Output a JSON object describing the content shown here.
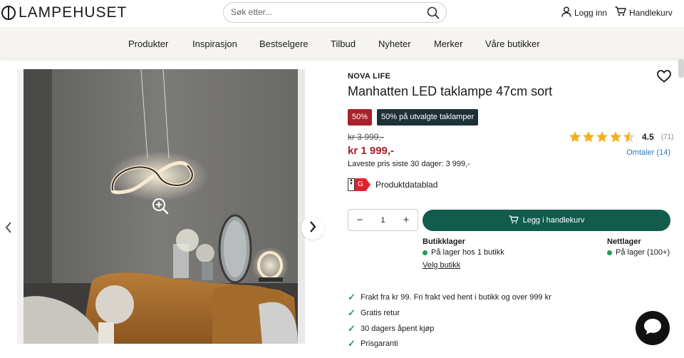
{
  "header": {
    "logo_text": "LAMPEHUSET",
    "search_placeholder": "Søk etter...",
    "login_label": "Logg inn",
    "cart_label": "Handlekurv"
  },
  "nav": {
    "items": [
      "Produkter",
      "Inspirasjon",
      "Bestselgere",
      "Tilbud",
      "Nyheter",
      "Merker",
      "Våre butikker"
    ]
  },
  "product": {
    "brand": "NOVA LIFE",
    "title": "Manhatten LED taklampe 47cm sort",
    "badge_discount": "50%",
    "badge_campaign": "50% på utvalgte taklamper",
    "old_price": "kr 3 999,-",
    "price": "kr 1 999,-",
    "lowest_price": "Laveste pris siste 30 dager: 3 999,-",
    "rating_value": "4.5",
    "rating_stars": 4.5,
    "rating_count": "(71)",
    "reviews_link": "Omtaler (14)",
    "energy_class": "G",
    "datasheet_label": "Produktdatablad",
    "quantity": "1",
    "add_to_cart_label": "Legg i handlekurv"
  },
  "stock": {
    "store_heading": "Butikklager",
    "store_status": "På lager hos 1 butikk",
    "online_heading": "Nettlager",
    "online_status": "På lager (100+)",
    "choose_store": "Velg butikk"
  },
  "usps": [
    "Frakt fra kr 99. Fri frakt ved hent i butikk og over 999 kr",
    "Gratis retur",
    "30 dagers åpent kjøp",
    "Prisgaranti"
  ],
  "colors": {
    "brand_green": "#125c4c",
    "sale_red": "#a8222c",
    "campaign_dark": "#1f3138",
    "star_gold": "#f2b01e",
    "in_stock_green": "#1e9e57"
  }
}
